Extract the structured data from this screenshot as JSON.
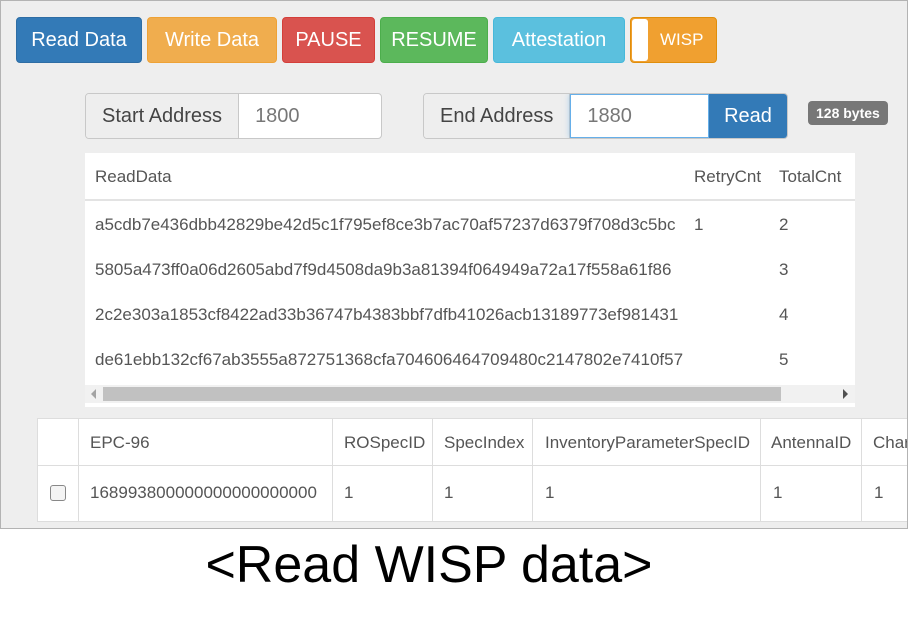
{
  "toolbar": {
    "read_data": "Read Data",
    "write_data": "Write Data",
    "pause": "PAUSE",
    "resume": "RESUME",
    "attestation": "Attestation",
    "wisp": "WISP"
  },
  "address": {
    "start_label": "Start Address",
    "start_value": "1800",
    "end_label": "End Address",
    "end_value": "1880",
    "read_button": "Read",
    "size_badge": "128 bytes"
  },
  "read_table": {
    "headers": [
      "ReadData",
      "RetryCnt",
      "TotalCnt"
    ],
    "rows": [
      {
        "data": "a5cdb7e436dbb42829be42d5c1f795ef8ce3b7ac70af57237d6379f708d3c5bc",
        "retry": "1",
        "total": "2"
      },
      {
        "data": "5805a473ff0a06d2605abd7f9d4508da9b3a81394f064949a72a17f558a61f86",
        "retry": "",
        "total": "3"
      },
      {
        "data": "2c2e303a1853cf8422ad33b36747b4383bbf7dfb41026acb13189773ef981431",
        "retry": "",
        "total": "4"
      },
      {
        "data": "de61ebb132cf67ab3555a872751368cfa704606464709480c2147802e7410f57",
        "retry": "",
        "total": "5"
      }
    ]
  },
  "epc_table": {
    "headers": [
      "EPC-96",
      "ROSpecID",
      "SpecIndex",
      "InventoryParameterSpecID",
      "AntennaID",
      "Char"
    ],
    "row": [
      "168993800000000000000000",
      "1",
      "1",
      "1",
      "1",
      "1"
    ]
  },
  "caption": "<Read WISP data>",
  "colors": {
    "primary": "#337ab7",
    "warning": "#f0ad4e",
    "danger": "#d9534f",
    "success": "#5cb85c",
    "info": "#5bc0de",
    "wisp": "#f0a030"
  }
}
